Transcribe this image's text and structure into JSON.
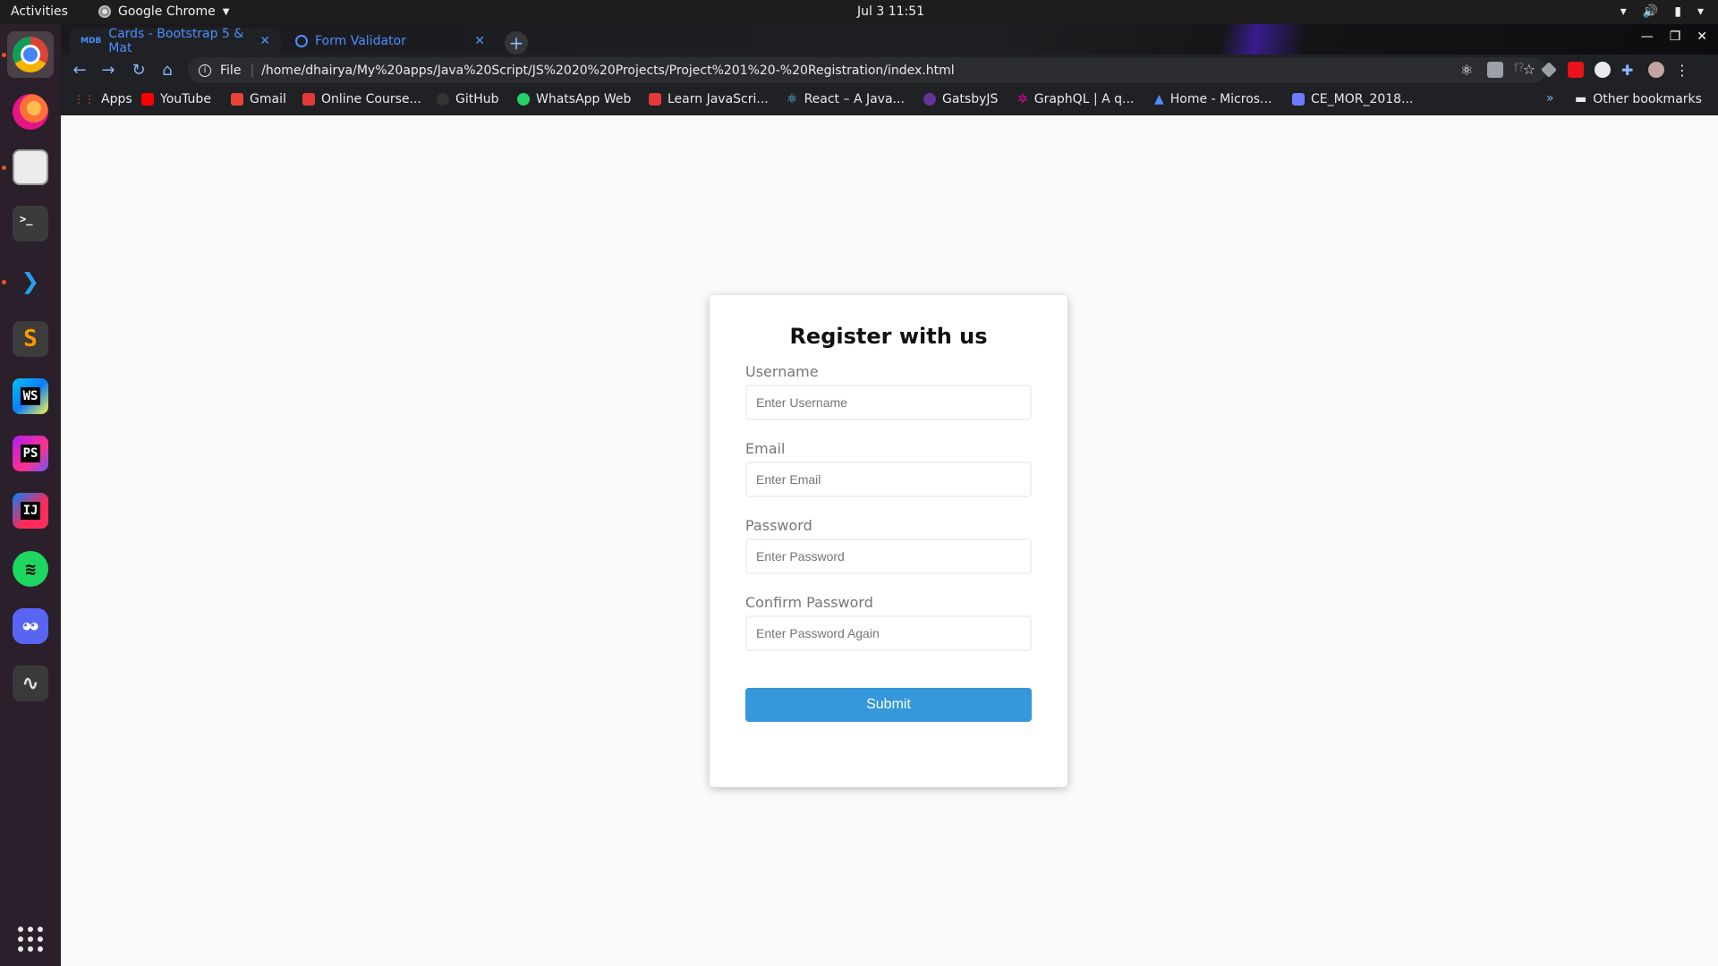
{
  "os": {
    "activities": "Activities",
    "app_name": "Google Chrome",
    "clock": "Jul 3  11:51"
  },
  "browser": {
    "tabs": [
      {
        "label": "Cards - Bootstrap 5 & Mat",
        "active": true
      },
      {
        "label": "Form Validator",
        "active": false
      }
    ],
    "new_tab_symbol": "+",
    "address": {
      "scheme": "File",
      "url": "/home/dhairya/My%20apps/Java%20Script/JS%2020%20Projects/Project%201%20-%20Registration/index.html"
    },
    "bookmarks": [
      {
        "label": "Apps",
        "color": "#ea4335"
      },
      {
        "label": "YouTube",
        "color": "#ff0000"
      },
      {
        "label": "Gmail",
        "color": "#ea4335"
      },
      {
        "label": "Online Course...",
        "color": "#e53935"
      },
      {
        "label": "GitHub",
        "color": "#333333"
      },
      {
        "label": "WhatsApp Web",
        "color": "#25d366"
      },
      {
        "label": "Learn JavaScri...",
        "color": "#e53935"
      },
      {
        "label": "React – A Java...",
        "color": "#61dafb"
      },
      {
        "label": "GatsbyJS",
        "color": "#663399"
      },
      {
        "label": "GraphQL | A q...",
        "color": "#e10098"
      },
      {
        "label": "Home - Micros...",
        "color": "#4d8eff"
      },
      {
        "label": "CE_MOR_2018...",
        "color": "#6f79ff"
      }
    ],
    "more_bookmarks": "»",
    "other_bookmarks": "Other bookmarks"
  },
  "form": {
    "title": "Register with us",
    "fields": [
      {
        "label": "Username",
        "placeholder": "Enter Username"
      },
      {
        "label": "Email",
        "placeholder": "Enter Email"
      },
      {
        "label": "Password",
        "placeholder": "Enter Password"
      },
      {
        "label": "Confirm Password",
        "placeholder": "Enter Password Again"
      }
    ],
    "submit_label": "Submit"
  },
  "colors": {
    "accent": "#3498db",
    "page_bg": "#f9fafb",
    "browser_chrome": "#202124"
  },
  "icons": [
    "chrome-icon",
    "firefox-icon",
    "files-icon",
    "terminal-icon",
    "vscode-icon",
    "sublime-icon",
    "webstorm-icon",
    "phpstorm-icon",
    "intellij-icon",
    "spotify-icon",
    "discord-icon",
    "system-monitor-icon",
    "show-apps-icon"
  ]
}
